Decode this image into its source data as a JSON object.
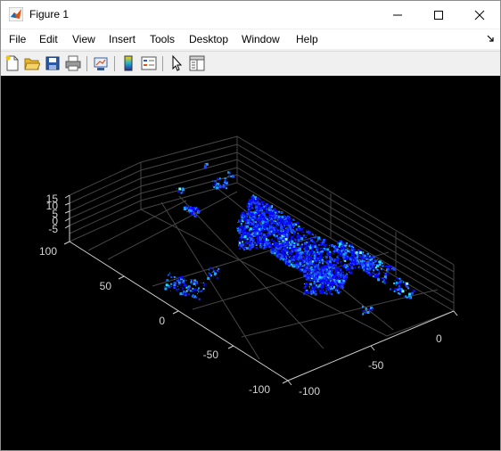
{
  "window": {
    "title": "Figure 1",
    "controls": [
      "minimize",
      "maximize",
      "close"
    ]
  },
  "menu": {
    "items": [
      "File",
      "Edit",
      "View",
      "Insert",
      "Tools",
      "Desktop",
      "Window",
      "Help"
    ]
  },
  "toolbar": {
    "buttons": [
      "new-figure",
      "open-file",
      "save-figure",
      "print-figure",
      "link-plot",
      "insert-colorbar",
      "insert-legend",
      "edit-plot",
      "open-property-inspector"
    ]
  },
  "plot": {
    "type": "3d-point-cloud",
    "colormap": [
      "#0a0aff",
      "#1e46ff",
      "#1fa0ff",
      "#22e0ff",
      "#7fffd4"
    ],
    "background": "#000000",
    "z_ticks": [
      "15",
      "10",
      "5",
      "0",
      "-5"
    ],
    "y_ticks": [
      "100",
      "50",
      "0",
      "-50",
      "-100"
    ],
    "x_ticks": [
      "-100",
      "-50",
      "0"
    ]
  },
  "colors": {
    "axis_line": "#cfcfcf",
    "grid": "#444444",
    "tick_text": "#d4d4d4",
    "titlebar": "#ffffff",
    "chrome": "#f0f0f0"
  }
}
